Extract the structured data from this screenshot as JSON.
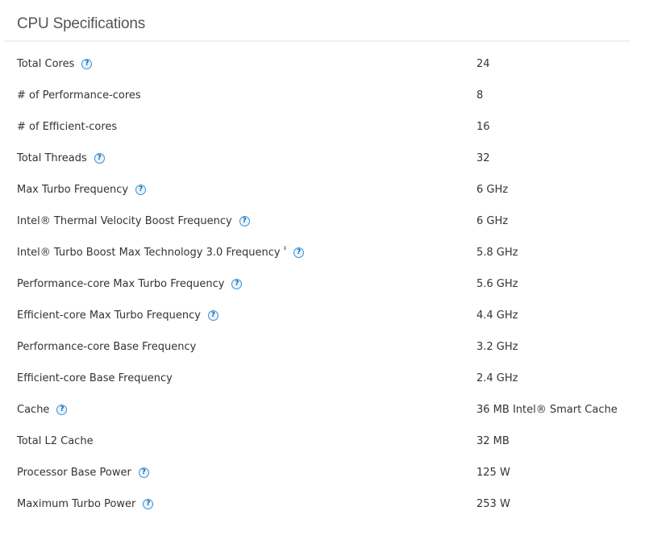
{
  "title": "CPU Specifications",
  "specs": [
    {
      "label": "Total Cores",
      "value": "24",
      "help": true,
      "sup": ""
    },
    {
      "label": "# of Performance-cores",
      "value": "8",
      "help": false,
      "sup": ""
    },
    {
      "label": "# of Efficient-cores",
      "value": "16",
      "help": false,
      "sup": ""
    },
    {
      "label": "Total Threads",
      "value": "32",
      "help": true,
      "sup": ""
    },
    {
      "label": "Max Turbo Frequency",
      "value": "6 GHz",
      "help": true,
      "sup": ""
    },
    {
      "label": "Intel® Thermal Velocity Boost Frequency",
      "value": "6 GHz",
      "help": true,
      "sup": ""
    },
    {
      "label": "Intel® Turbo Boost Max Technology 3.0 Frequency",
      "value": "5.8 GHz",
      "help": true,
      "sup": "‡"
    },
    {
      "label": "Performance-core Max Turbo Frequency",
      "value": "5.6 GHz",
      "help": true,
      "sup": ""
    },
    {
      "label": "Efficient-core Max Turbo Frequency",
      "value": "4.4 GHz",
      "help": true,
      "sup": ""
    },
    {
      "label": "Performance-core Base Frequency",
      "value": "3.2 GHz",
      "help": false,
      "sup": ""
    },
    {
      "label": "Efficient-core Base Frequency",
      "value": "2.4 GHz",
      "help": false,
      "sup": ""
    },
    {
      "label": "Cache",
      "value": "36 MB Intel® Smart Cache",
      "help": true,
      "sup": ""
    },
    {
      "label": "Total L2 Cache",
      "value": "32 MB",
      "help": false,
      "sup": ""
    },
    {
      "label": "Processor Base Power",
      "value": "125 W",
      "help": true,
      "sup": ""
    },
    {
      "label": "Maximum Turbo Power",
      "value": "253 W",
      "help": true,
      "sup": ""
    }
  ],
  "help_icon_glyph": "?",
  "colors": {
    "help_icon": "#0068b5",
    "text": "#333333",
    "title": "#555555",
    "divider": "#f0f0f0"
  }
}
